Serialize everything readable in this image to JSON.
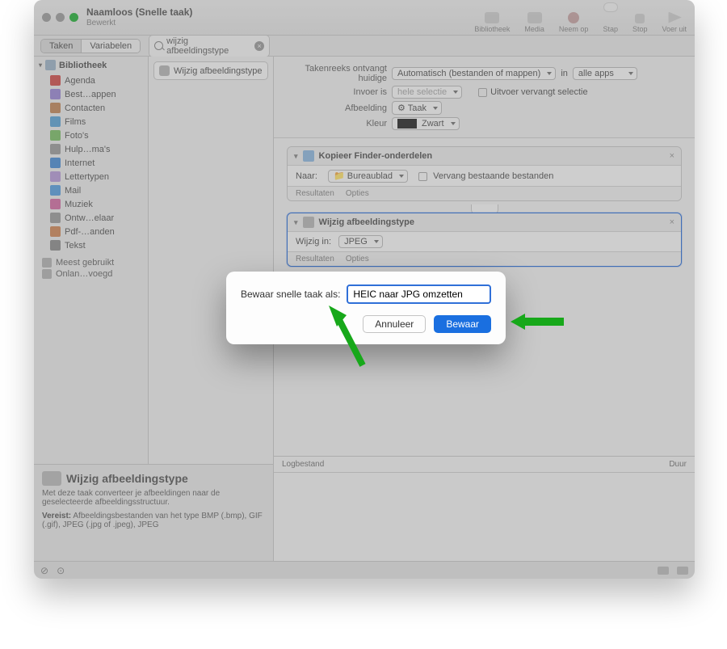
{
  "title": {
    "main": "Naamloos (Snelle taak)",
    "sub": "Bewerkt"
  },
  "toolbar": {
    "buttons": [
      {
        "label": "Bibliotheek"
      },
      {
        "label": "Media"
      },
      {
        "label": "Neem op"
      },
      {
        "label": "Stap"
      },
      {
        "label": "Stop"
      },
      {
        "label": "Voer uit"
      }
    ]
  },
  "tabs": {
    "taken": "Taken",
    "variabelen": "Variabelen"
  },
  "search": {
    "placeholder": "wijzig afbeeldingstype"
  },
  "sidebar": {
    "header": "Bibliotheek",
    "items": [
      {
        "label": "Agenda",
        "color": "#d0534f"
      },
      {
        "label": "Best…appen",
        "color": "#9c8ad6"
      },
      {
        "label": "Contacten",
        "color": "#c38a5d"
      },
      {
        "label": "Films",
        "color": "#5fa6d6"
      },
      {
        "label": "Foto's",
        "color": "#7fbf6a"
      },
      {
        "label": "Hulp…ma's",
        "color": "#9d9d9d"
      },
      {
        "label": "Internet",
        "color": "#4e8fd6"
      },
      {
        "label": "Lettertypen",
        "color": "#b79bd8"
      },
      {
        "label": "Mail",
        "color": "#5aa0e0"
      },
      {
        "label": "Muziek",
        "color": "#d46fa7"
      },
      {
        "label": "Ontw…elaar",
        "color": "#9d9d9d"
      },
      {
        "label": "Pdf-…anden",
        "color": "#d08a5a"
      },
      {
        "label": "Tekst",
        "color": "#8f8f8f"
      }
    ],
    "extras": [
      {
        "label": "Meest gebruikt"
      },
      {
        "label": "Onlan…voegd"
      }
    ]
  },
  "actionList": {
    "action": "Wijzig afbeeldingstype"
  },
  "props": {
    "rowLabels": {
      "receives": "Takenreeks ontvangt huidige",
      "in": "in",
      "input": "Invoer is",
      "image": "Afbeelding",
      "color": "Kleur"
    },
    "receivesValue": "Automatisch (bestanden of mappen)",
    "appsValue": "alle apps",
    "inputValue": "hele selectie",
    "outputReplaces": "Uitvoer vervangt selectie",
    "imageValue": "Taak",
    "colorValue": "Zwart"
  },
  "step1": {
    "title": "Kopieer Finder-onderdelen",
    "toLabel": "Naar:",
    "toValue": "Bureaublad",
    "replaceLabel": "Vervang bestaande bestanden",
    "footResults": "Resultaten",
    "footOptions": "Opties"
  },
  "step2": {
    "title": "Wijzig afbeeldingstype",
    "changeLabel": "Wijzig in:",
    "changeValue": "JPEG",
    "footResults": "Resultaten",
    "footOptions": "Opties"
  },
  "log": {
    "col1": "Logbestand",
    "col2": "Duur"
  },
  "help": {
    "title": "Wijzig afbeeldingstype",
    "desc": "Met deze taak converteer je afbeeldingen naar de geselecteerde afbeeldingsstructuur.",
    "reqLabel": "Vereist:",
    "reqText": "Afbeeldingsbestanden van het type BMP (.bmp), GIF (.gif), JPEG (.jpg of .jpeg), JPEG"
  },
  "modal": {
    "prompt": "Bewaar snelle taak als:",
    "value": "HEIC naar JPG omzetten",
    "cancel": "Annuleer",
    "save": "Bewaar"
  }
}
